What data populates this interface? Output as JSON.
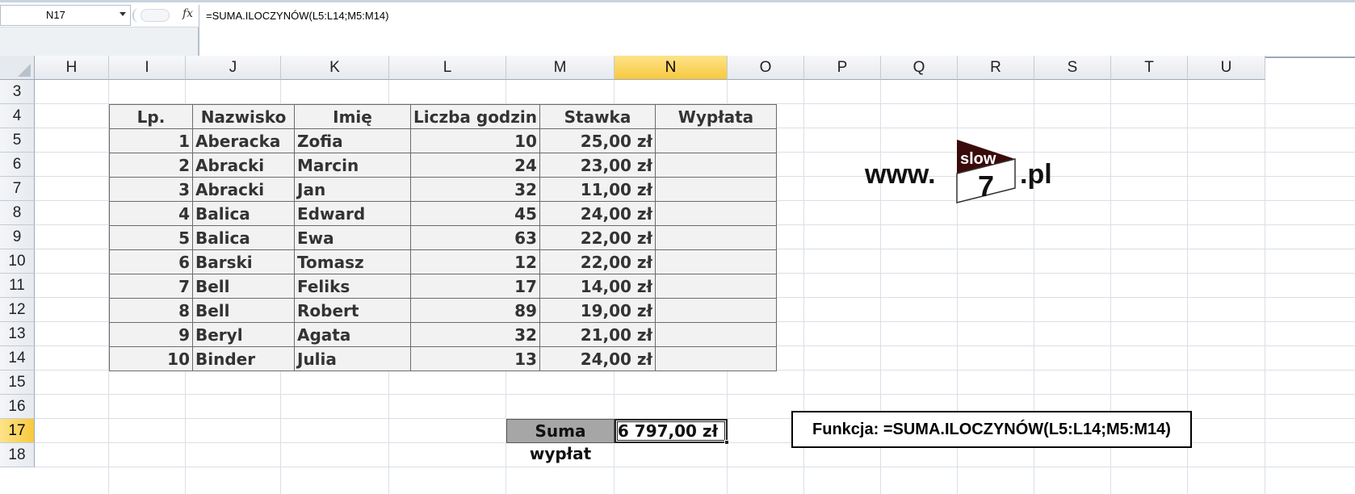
{
  "formula_bar": {
    "name_box": "N17",
    "fx_label": "fx",
    "formula": "=SUMA.ILOCZYNÓW(L5:L14;M5:M14)"
  },
  "columns": [
    "H",
    "I",
    "J",
    "K",
    "L",
    "M",
    "N",
    "O",
    "P",
    "Q",
    "R",
    "S",
    "T",
    "U"
  ],
  "active_column": "N",
  "rows": [
    "3",
    "4",
    "5",
    "6",
    "7",
    "8",
    "9",
    "10",
    "11",
    "12",
    "13",
    "14",
    "15",
    "16",
    "17",
    "18"
  ],
  "active_row": "17",
  "table": {
    "headers": [
      "Lp.",
      "Nazwisko",
      "Imię",
      "Liczba godzin",
      "Stawka",
      "Wypłata"
    ],
    "rows": [
      {
        "lp": "1",
        "nazwisko": "Aberacka",
        "imie": "Zofia",
        "godziny": "10",
        "stawka": "25,00 zł",
        "wyplata": ""
      },
      {
        "lp": "2",
        "nazwisko": "Abracki",
        "imie": "Marcin",
        "godziny": "24",
        "stawka": "23,00 zł",
        "wyplata": ""
      },
      {
        "lp": "3",
        "nazwisko": "Abracki",
        "imie": "Jan",
        "godziny": "32",
        "stawka": "11,00 zł",
        "wyplata": ""
      },
      {
        "lp": "4",
        "nazwisko": "Balica",
        "imie": "Edward",
        "godziny": "45",
        "stawka": "24,00 zł",
        "wyplata": ""
      },
      {
        "lp": "5",
        "nazwisko": "Balica",
        "imie": "Ewa",
        "godziny": "63",
        "stawka": "22,00 zł",
        "wyplata": ""
      },
      {
        "lp": "6",
        "nazwisko": "Barski",
        "imie": "Tomasz",
        "godziny": "12",
        "stawka": "22,00 zł",
        "wyplata": ""
      },
      {
        "lp": "7",
        "nazwisko": "Bell",
        "imie": "Feliks",
        "godziny": "17",
        "stawka": "14,00 zł",
        "wyplata": ""
      },
      {
        "lp": "8",
        "nazwisko": "Bell",
        "imie": "Robert",
        "godziny": "89",
        "stawka": "19,00 zł",
        "wyplata": ""
      },
      {
        "lp": "9",
        "nazwisko": "Beryl",
        "imie": "Agata",
        "godziny": "32",
        "stawka": "21,00 zł",
        "wyplata": ""
      },
      {
        "lp": "10",
        "nazwisko": "Binder",
        "imie": "Julia",
        "godziny": "13",
        "stawka": "24,00 zł",
        "wyplata": ""
      }
    ]
  },
  "summary": {
    "label": "Suma wypłat",
    "value": "6 797,00 zł"
  },
  "note": "Funkcja: =SUMA.ILOCZYNÓW(L5:L14;M5:M14)",
  "logo": {
    "prefix": "www.",
    "badge_text": "slow",
    "badge_number": "7",
    "suffix": ".pl",
    "colors": {
      "dark": "#3a0b0b",
      "light": "#ffffff"
    }
  }
}
